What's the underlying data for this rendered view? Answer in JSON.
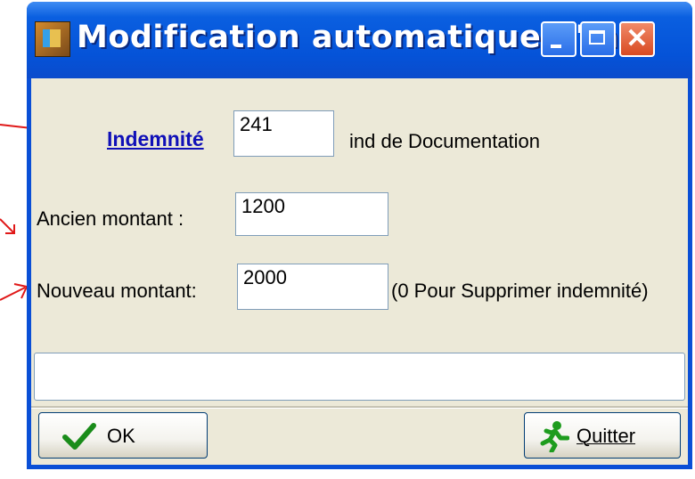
{
  "window": {
    "title": "Modification automatique d'in...",
    "controls": {
      "minimize": "minimize",
      "maximize": "maximize",
      "close": "✕"
    }
  },
  "form": {
    "indemnite": {
      "label": "Indemnité",
      "value": "241",
      "description": "ind de Documentation"
    },
    "ancien": {
      "label": "Ancien montant  :",
      "value": "1200"
    },
    "nouveau": {
      "label": "Nouveau montant:",
      "value": "2000",
      "hint": "(0 Pour Supprimer indemnité)"
    },
    "status_text": ""
  },
  "buttons": {
    "ok": {
      "label": "OK",
      "icon": "checkmark-icon"
    },
    "quit": {
      "label": "Quitter",
      "icon": "running-man-icon"
    }
  },
  "colors": {
    "titlebar": "#0553d8",
    "client": "#ece9d8",
    "link": "#1010b8",
    "annotation_arrow": "#e01818"
  }
}
